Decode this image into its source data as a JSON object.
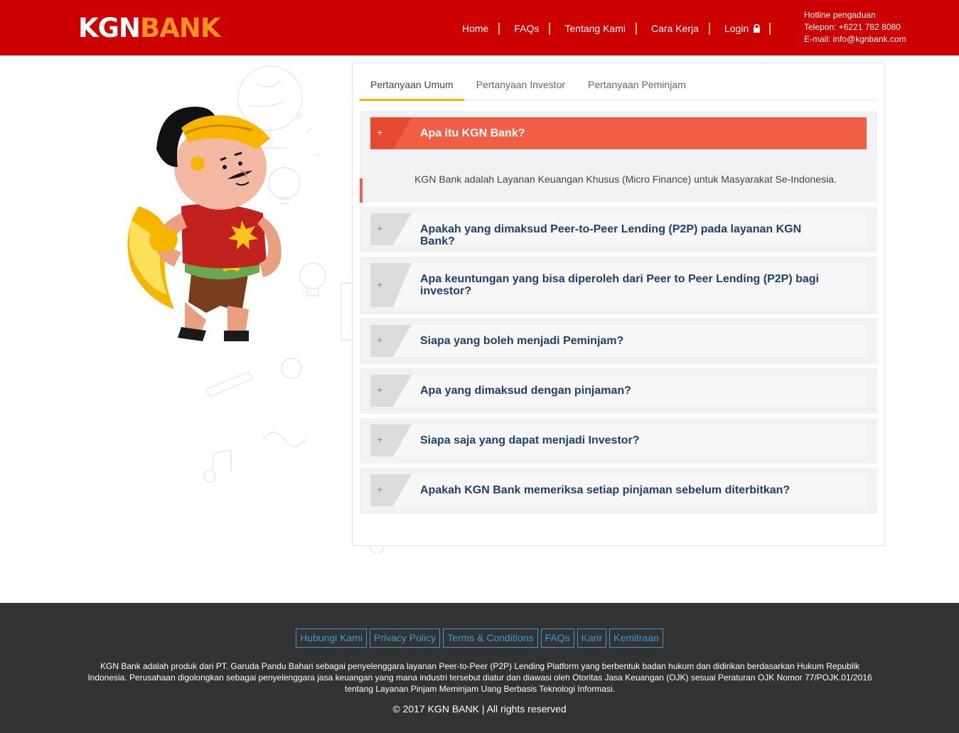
{
  "header": {
    "logo_part1": "KGN",
    "logo_part2": "BANK",
    "nav": [
      {
        "label": "Home"
      },
      {
        "label": "FAQs"
      },
      {
        "label": "Tentang Kami"
      },
      {
        "label": "Cara Kerja"
      },
      {
        "label": "Login"
      }
    ],
    "hotline": {
      "title": "Hotline pengaduan",
      "phone": "Telepon: +6221 782 8080",
      "email": "E-mail: info@kgnbank.com"
    }
  },
  "tabs": [
    {
      "label": "Pertanyaan Umum",
      "active": true
    },
    {
      "label": "Pertanyaan Investor"
    },
    {
      "label": "Pertanyaan Peminjam"
    }
  ],
  "faq": [
    {
      "question": "Apa itu KGN Bank?",
      "answer": "KGN Bank adalah Layanan Keuangan Khusus (Micro Finance) untuk Masyarakat Se-Indonesia.",
      "open": true
    },
    {
      "question": "Apakah yang dimaksud Peer-to-Peer Lending (P2P) pada layanan KGN Bank?"
    },
    {
      "question": "Apa keuntungan yang bisa diperoleh dari Peer to Peer Lending (P2P) bagi investor?"
    },
    {
      "question": "Siapa yang boleh menjadi Peminjam?"
    },
    {
      "question": "Apa yang dimaksud dengan pinjaman?"
    },
    {
      "question": "Siapa saja yang dapat menjadi Investor?"
    },
    {
      "question": "Apakah KGN Bank memeriksa setiap pinjaman sebelum diterbitkan?"
    }
  ],
  "accordion_icon": "+",
  "footer": {
    "links": [
      "Hubungi Kami",
      "Privacy Policy",
      "Terms & Conditions",
      "FAQs",
      "Karir",
      "Kemitraan"
    ],
    "description": "KGN Bank adalah produk dari PT. Garuda Pandu Bahari sebagai penyelenggara layanan Peer-to-Peer (P2P) Lending Platform yang berbentuk badan hukum dan didirikan berdasarkan Hukum Republik Indonesia. Perusahaan digolongkan sebagai penyelenggara jasa keuangan yang mana industri tersebut diatur dan diawasi oleh Otoritas Jasa Keuangan (OJK) sesuai Peraturan OJK Nomor 77/POJK.01/2016 tentang Layanan Pinjam Meminjam Uang Berbasis Teknologi Informasi.",
    "copyright": "© 2017 KGN BANK | All rights reserved"
  },
  "colors": {
    "header_bg": "#cc0000",
    "logo_accent": "#f7941d",
    "nav_separator": "#f7c31d",
    "tab_active": "#f7b500",
    "accordion_open": "#f05f45",
    "question_text": "#1f3f6e",
    "footer_bg": "#333333",
    "footer_link": "#3b9bd8"
  },
  "icons": [
    "lock-icon",
    "wayang-mascot-illustration",
    "background-doodles"
  ]
}
